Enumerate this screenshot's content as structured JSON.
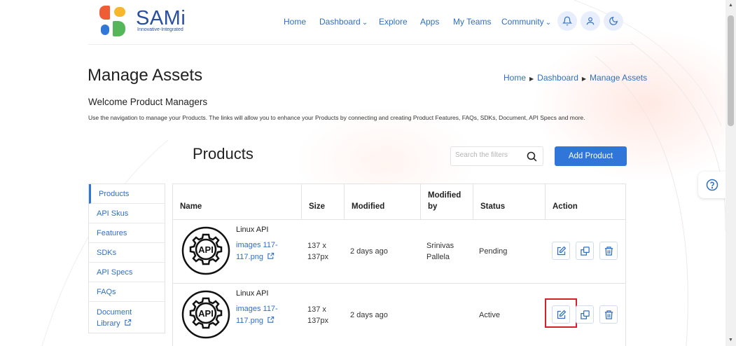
{
  "brand": {
    "name": "SAMi",
    "tagline": "Innovative-Integrated",
    "colors": {
      "red": "#ef5d37",
      "yellow": "#f6b72d",
      "blue": "#2f78d6",
      "green": "#56b65a",
      "text": "#2a4fa0"
    }
  },
  "nav": {
    "items": [
      "Home",
      "Dashboard",
      "Explore",
      "Apps",
      "My Teams",
      "Community"
    ],
    "icons": [
      "bell-icon",
      "user-icon",
      "moon-icon"
    ]
  },
  "page": {
    "title": "Manage Assets",
    "breadcrumb": [
      "Home",
      "Dashboard",
      "Manage Assets"
    ],
    "welcome": "Welcome Product Managers",
    "description": "Use the navigation to manage your Products. The links will allow you to enhance your Products by connecting and creating Product Features, FAQs, SDKs, Document, API Specs and more."
  },
  "products": {
    "title": "Products",
    "search_placeholder": "Search the filters",
    "add_label": "Add Product"
  },
  "sidebar": {
    "items": [
      "Products",
      "API Skus",
      "Features",
      "SDKs",
      "API Specs",
      "FAQs",
      "Document Library"
    ],
    "active": "Products"
  },
  "table": {
    "headers": [
      "Name",
      "Size",
      "Modified",
      "Modified by",
      "Status",
      "Action"
    ],
    "rows": [
      {
        "name": "Linux API",
        "file": "images 117-117.png",
        "size": "137 x 137px",
        "modified": "2 days ago",
        "modified_by": "Srinivas Pallela",
        "status": "Pending"
      },
      {
        "name": "Linux API",
        "file": "images 117-117.png",
        "size": "137 x 137px",
        "modified": "2 days ago",
        "modified_by": "",
        "status": "Active"
      }
    ]
  },
  "accent_color": "#2f76d8",
  "highlight_color": "#d6202a"
}
